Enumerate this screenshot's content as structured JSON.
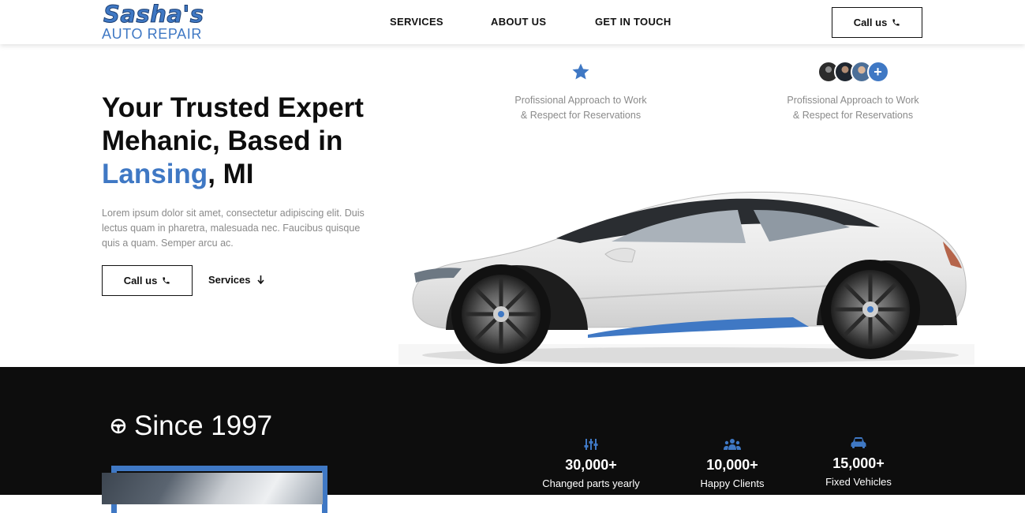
{
  "header": {
    "logo_top": "Sasha's",
    "logo_bottom": "AUTO REPAIR",
    "nav": [
      "SERVICES",
      "ABOUT US",
      "GET IN TOUCH"
    ],
    "call_label": "Call us"
  },
  "hero": {
    "title_line1": "Your Trusted Expert",
    "title_line2": "Mehanic, Based in",
    "title_accent": "Lansing",
    "title_rest": ", MI",
    "text": "Lorem ipsum dolor sit amet, consectetur adipiscing elit. Duis lectus quam in pharetra, malesuada nec. Faucibus quisque quis a quam. Semper arcu ac.",
    "call_label": "Call us",
    "services_label": "Services"
  },
  "features": [
    {
      "icon": "star-icon",
      "line1": "Profissional Approach to Work",
      "line2": "& Respect for Reservations"
    },
    {
      "icon": "avatars",
      "line1": "Profissional Approach to Work",
      "line2": "& Respect for Reservations"
    }
  ],
  "avatar_plus": "+",
  "history": {
    "title": "Since 1997"
  },
  "stats": [
    {
      "icon": "sliders-icon",
      "value": "30,000+",
      "label": "Changed parts yearly"
    },
    {
      "icon": "users-icon",
      "value": "10,000+",
      "label": "Happy Clients"
    },
    {
      "icon": "car-icon",
      "value": "15,000+",
      "label": "Fixed Vehicles"
    }
  ],
  "colors": {
    "accent": "#3f78c4",
    "dark_bg": "#0d0d0d",
    "text_muted": "#8a8a8a"
  }
}
